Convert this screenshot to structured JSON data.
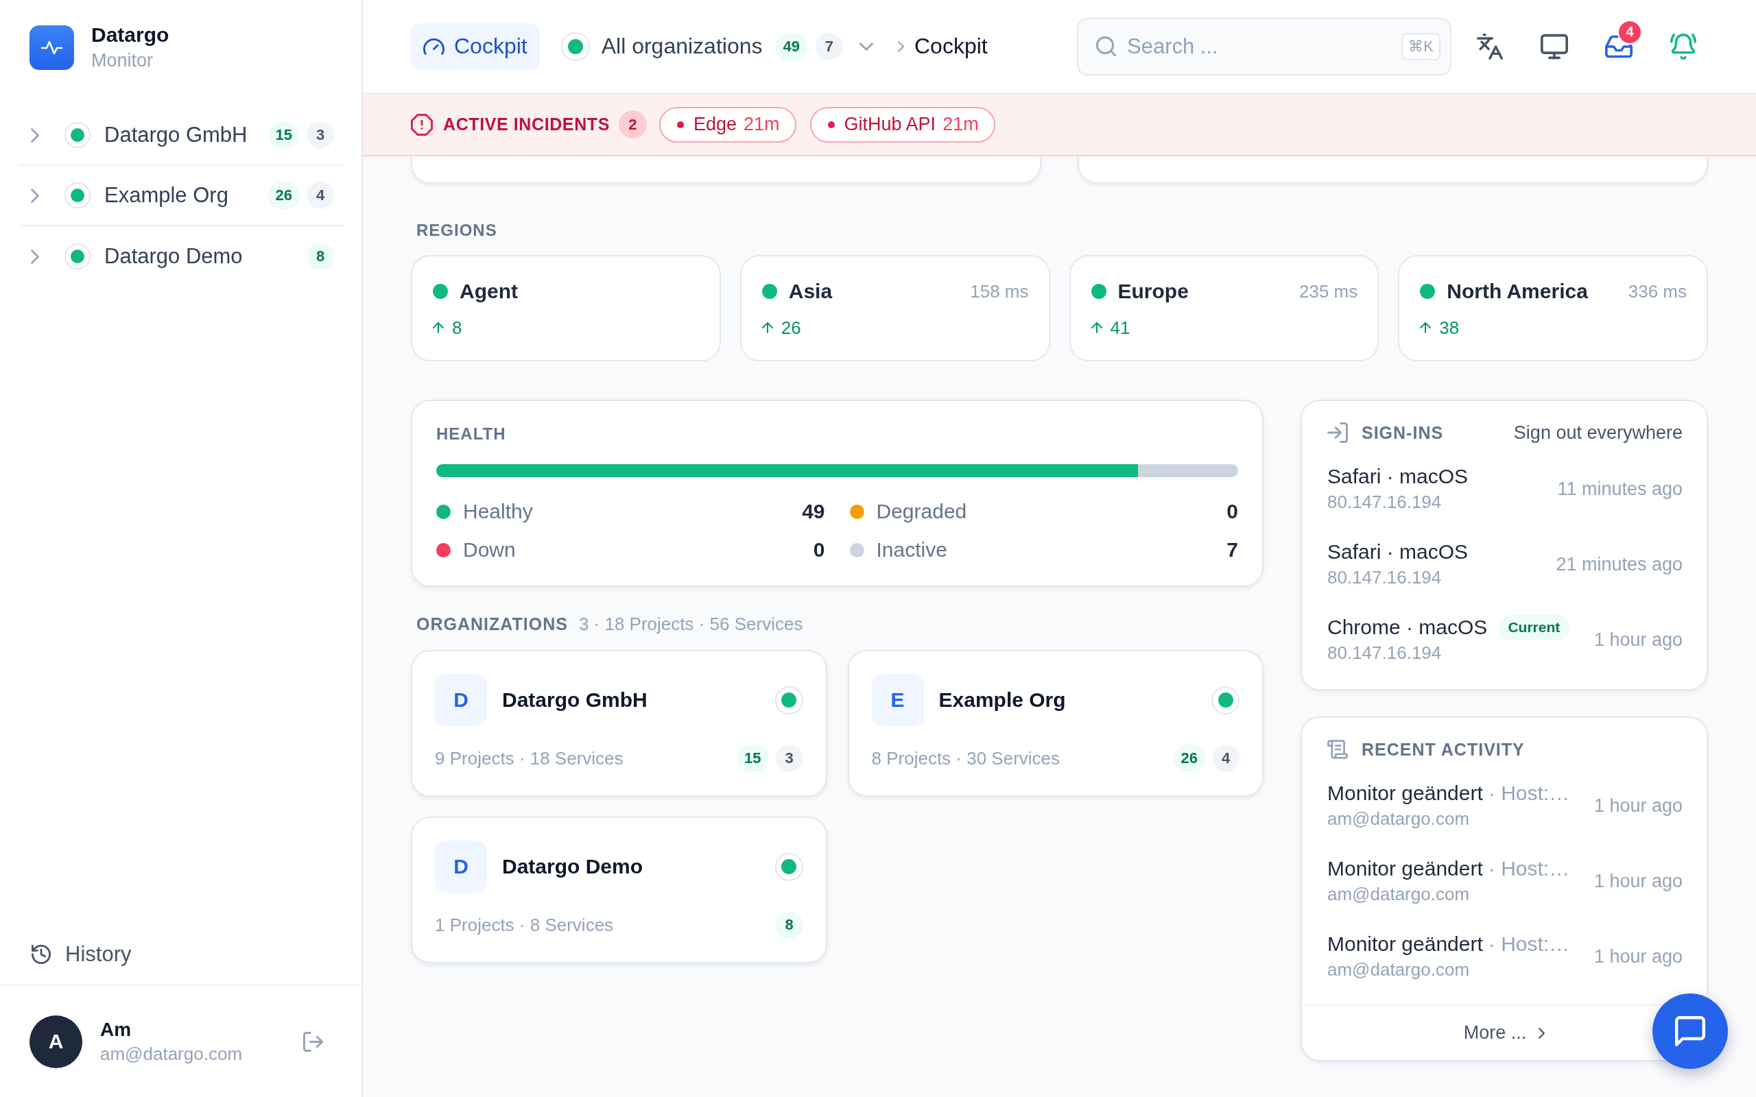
{
  "sidebar": {
    "brand": {
      "name": "Datargo",
      "subtitle": "Monitor"
    },
    "organizations": [
      {
        "name": "Datargo GmbH",
        "expanded": false,
        "online": true,
        "up_count": "15",
        "inactive_count": "3"
      },
      {
        "name": "Example Org",
        "expanded": false,
        "online": true,
        "up_count": "26",
        "inactive_count": "4"
      },
      {
        "name": "Datargo Demo",
        "expanded": false,
        "online": true,
        "up_count": "8"
      }
    ],
    "history": {
      "label": "History"
    },
    "user": {
      "initial": "A",
      "name": "Am",
      "email": "am@datargo.com"
    }
  },
  "header": {
    "home": {
      "label": "Cockpit",
      "selected": true
    },
    "scope": {
      "online": true,
      "label": "All organizations",
      "up_count": "49",
      "inactive_count": "7"
    },
    "breadcrumb": [
      "Cockpit"
    ],
    "search": {
      "placeholder": "Search ...",
      "shortcut": "⌘K"
    },
    "inbox_count": "4"
  },
  "incidents": {
    "label": "ACTIVE INCIDENTS",
    "count": "2",
    "items": [
      {
        "name": "Edge",
        "duration": "21m"
      },
      {
        "name": "GitHub API",
        "duration": "21m"
      }
    ]
  },
  "regions": {
    "title": "REGIONS",
    "items": [
      {
        "name": "Agent",
        "online": true,
        "up_count": "8"
      },
      {
        "name": "Asia",
        "online": true,
        "latency": "158 ms",
        "up_count": "26"
      },
      {
        "name": "Europe",
        "online": true,
        "latency": "235 ms",
        "up_count": "41"
      },
      {
        "name": "North America",
        "online": true,
        "latency": "336 ms",
        "up_count": "38"
      }
    ]
  },
  "health": {
    "title": "HEALTH",
    "level": 0.875,
    "legend": [
      {
        "label": "Healthy",
        "value": "49",
        "color": "#10b981"
      },
      {
        "label": "Degraded",
        "value": "0",
        "color": "#f59e0b"
      },
      {
        "label": "Down",
        "value": "0",
        "color": "#f43f5e"
      },
      {
        "label": "Inactive",
        "value": "7",
        "color": "#cbd5e1"
      }
    ]
  },
  "organizations": {
    "title": "ORGANIZATIONS",
    "summary": "3 · 18 Projects · 56 Services",
    "items": [
      {
        "initial": "D",
        "name": "Datargo GmbH",
        "online": true,
        "meta": "9 Projects · 18 Services",
        "up_count": "15",
        "inactive_count": "3"
      },
      {
        "initial": "E",
        "name": "Example Org",
        "online": true,
        "meta": "8 Projects · 30 Services",
        "up_count": "26",
        "inactive_count": "4"
      },
      {
        "initial": "D",
        "name": "Datargo Demo",
        "online": true,
        "meta": "1 Projects · 8 Services",
        "up_count": "8"
      }
    ]
  },
  "sign_ins": {
    "title": "SIGN-INS",
    "action": "Sign out everywhere",
    "items": [
      {
        "device": "Safari · macOS",
        "ip": "80.147.16.194",
        "time": "11 minutes ago"
      },
      {
        "device": "Safari · macOS",
        "ip": "80.147.16.194",
        "time": "21 minutes ago"
      },
      {
        "device": "Chrome · macOS",
        "badge": "Current",
        "ip": "80.147.16.194",
        "time": "1 hour ago"
      }
    ]
  },
  "recent_activity": {
    "title": "RECENT ACTIVITY",
    "items": [
      {
        "action": "Monitor geändert",
        "detail": "· Host:…",
        "user": "am@datargo.com",
        "time": "1 hour ago"
      },
      {
        "action": "Monitor geändert",
        "detail": "· Host:…",
        "user": "am@datargo.com",
        "time": "1 hour ago"
      },
      {
        "action": "Monitor geändert",
        "detail": "· Host:…",
        "user": "am@datargo.com",
        "time": "1 hour ago"
      }
    ],
    "more": "More ..."
  }
}
